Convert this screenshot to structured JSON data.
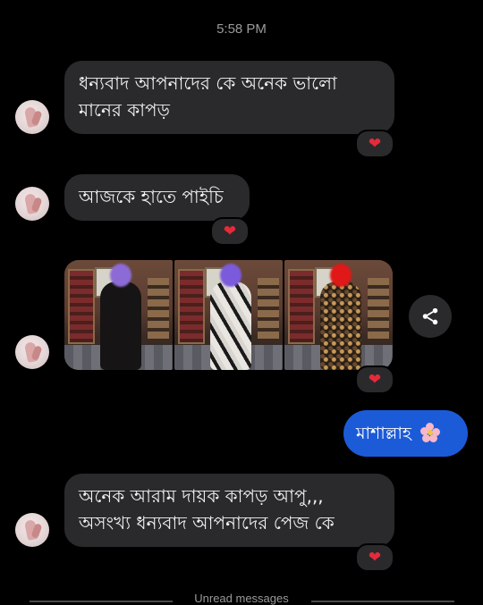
{
  "header": {
    "timestamp": "5:58 PM"
  },
  "messages": [
    {
      "direction": "incoming",
      "text_line1": "ধন্যবাদ আপনাদের কে অনেক ভালো",
      "text_line2": "মানের কাপড়",
      "reaction": "❤"
    },
    {
      "direction": "incoming",
      "text": "আজকে হাতে পাইচি",
      "reaction": "❤"
    },
    {
      "direction": "incoming",
      "type": "photo-group",
      "photos": [
        "photo",
        "photo",
        "photo"
      ],
      "reaction": "❤"
    },
    {
      "direction": "outgoing",
      "text": "মাশাল্লাহ",
      "emoji": "flower-icon"
    },
    {
      "direction": "incoming",
      "text_line1": "অনেক আরাম দায়ক  কাপড় আপু,,,",
      "text_line2": "অসংখ্য ধন্যবাদ  আপনাদের পেজ কে",
      "reaction": "❤"
    }
  ],
  "divider": {
    "label": "Unread messages"
  },
  "icons": {
    "share": "share-icon",
    "reaction": "heart-icon",
    "avatar": "avatar-icon"
  },
  "colors": {
    "background": "#000000",
    "incoming_bubble": "#2a2a2c",
    "outgoing_bubble": "#1c5bd8",
    "heart": "#e52a3a",
    "timestamp": "#9a9a9a"
  }
}
